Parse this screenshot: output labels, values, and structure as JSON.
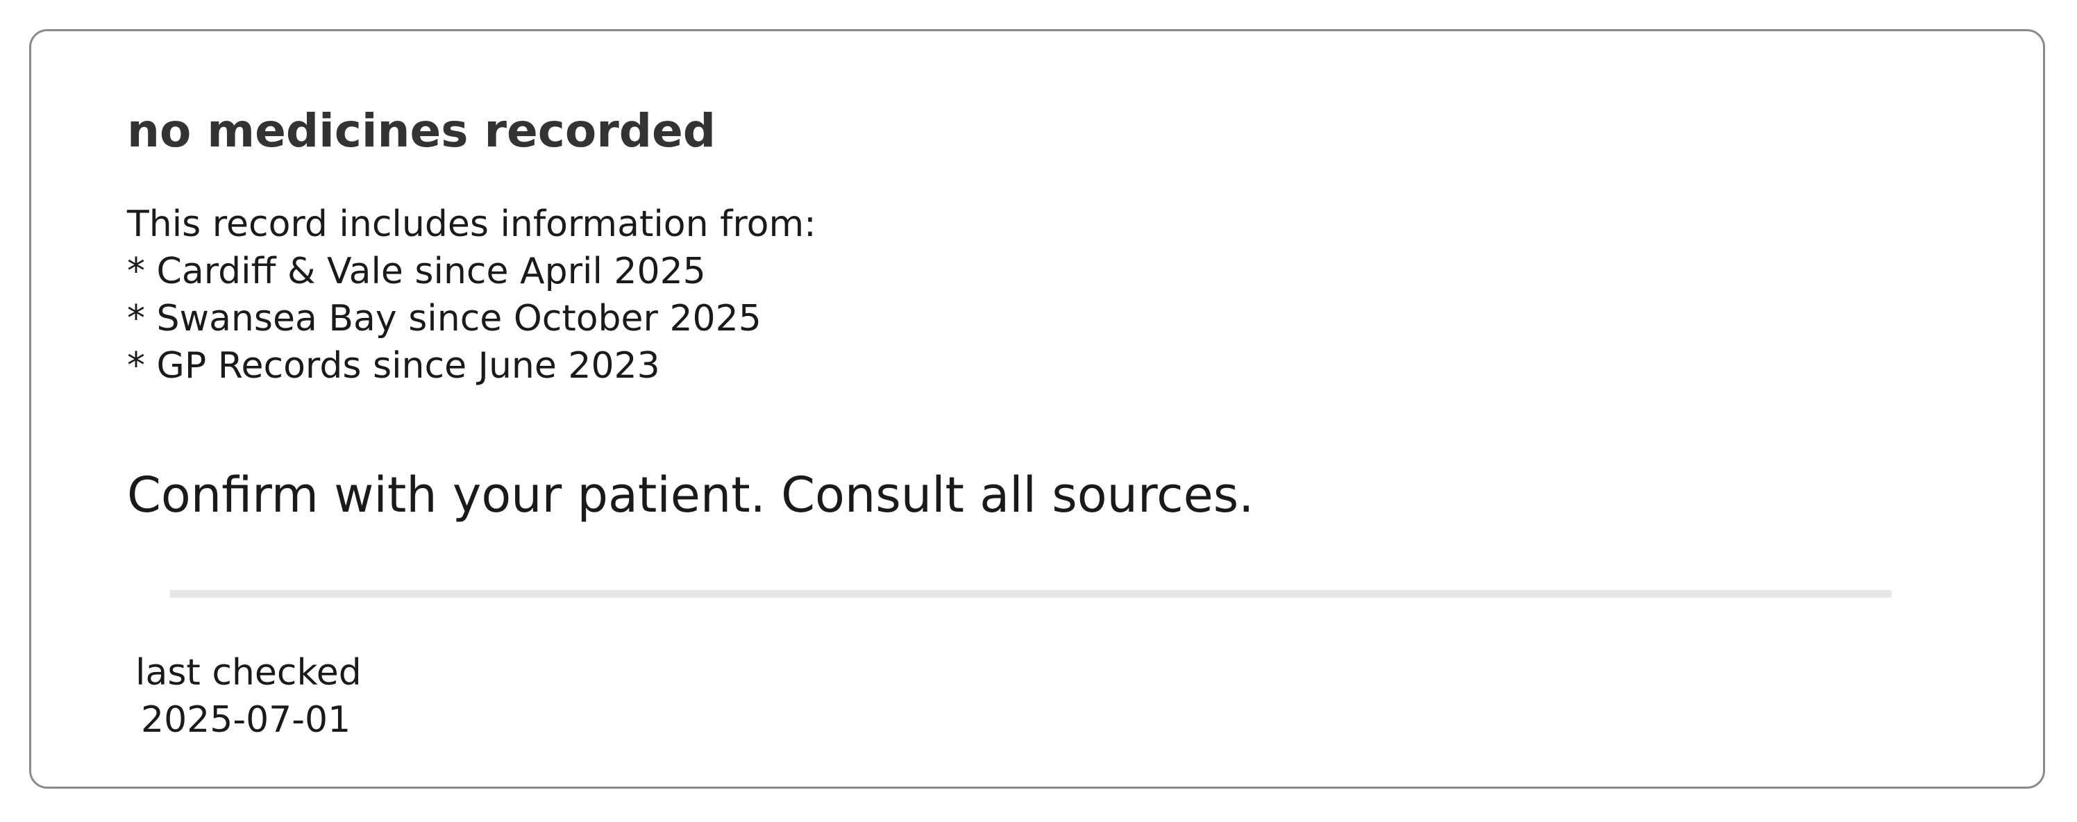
{
  "card": {
    "title": "no medicines recorded",
    "sources_intro": "This record includes information from:",
    "sources": [
      "* Cardiff & Vale since April 2025",
      "* Swansea Bay since October 2025",
      "* GP Records since June 2023"
    ],
    "warning": "Confirm with your patient. Consult all sources.",
    "last_checked_label": "last checked",
    "last_checked_date": "2025-07-01"
  },
  "colors": {
    "border": "#8a8a8a",
    "title": "#333333",
    "text": "#1a1a1a",
    "divider": "#e6e6e6",
    "background": "#ffffff"
  }
}
